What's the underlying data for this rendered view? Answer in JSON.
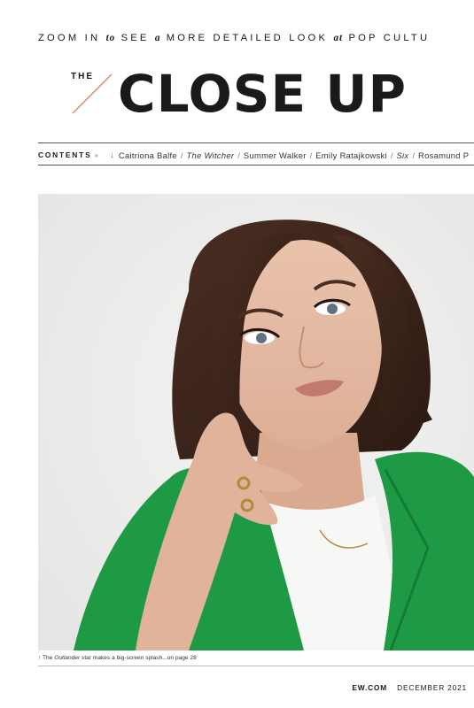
{
  "tagline": {
    "p1": "ZOOM IN ",
    "p2": "to",
    "p3": " SEE ",
    "p4": "a",
    "p5": " MORE DETAILED LOOK ",
    "p6": "at",
    "p7": " POP CULTU"
  },
  "masthead": {
    "the": "THE",
    "title": "CLOSE UP"
  },
  "contents": {
    "label": "CONTENTS",
    "marker": "»",
    "arrow": "↓",
    "items": [
      "Caitriona Balfe",
      "The Witcher",
      "Summer Walker",
      "Emily Ratajkowski",
      "Six",
      "Rosamund P"
    ],
    "separator": "/"
  },
  "caption": {
    "arrow": "↑",
    "pre": "The ",
    "show": "Outlander",
    "post": " star makes a big-screen splash...on page 28"
  },
  "footer": {
    "site": "EW.COM",
    "date": "DECEMBER 2021"
  },
  "colors": {
    "accent": "#e05a2a",
    "text": "#1a1a1a",
    "photo_background": "#ededec",
    "jacket_green": "#1e9a45"
  }
}
